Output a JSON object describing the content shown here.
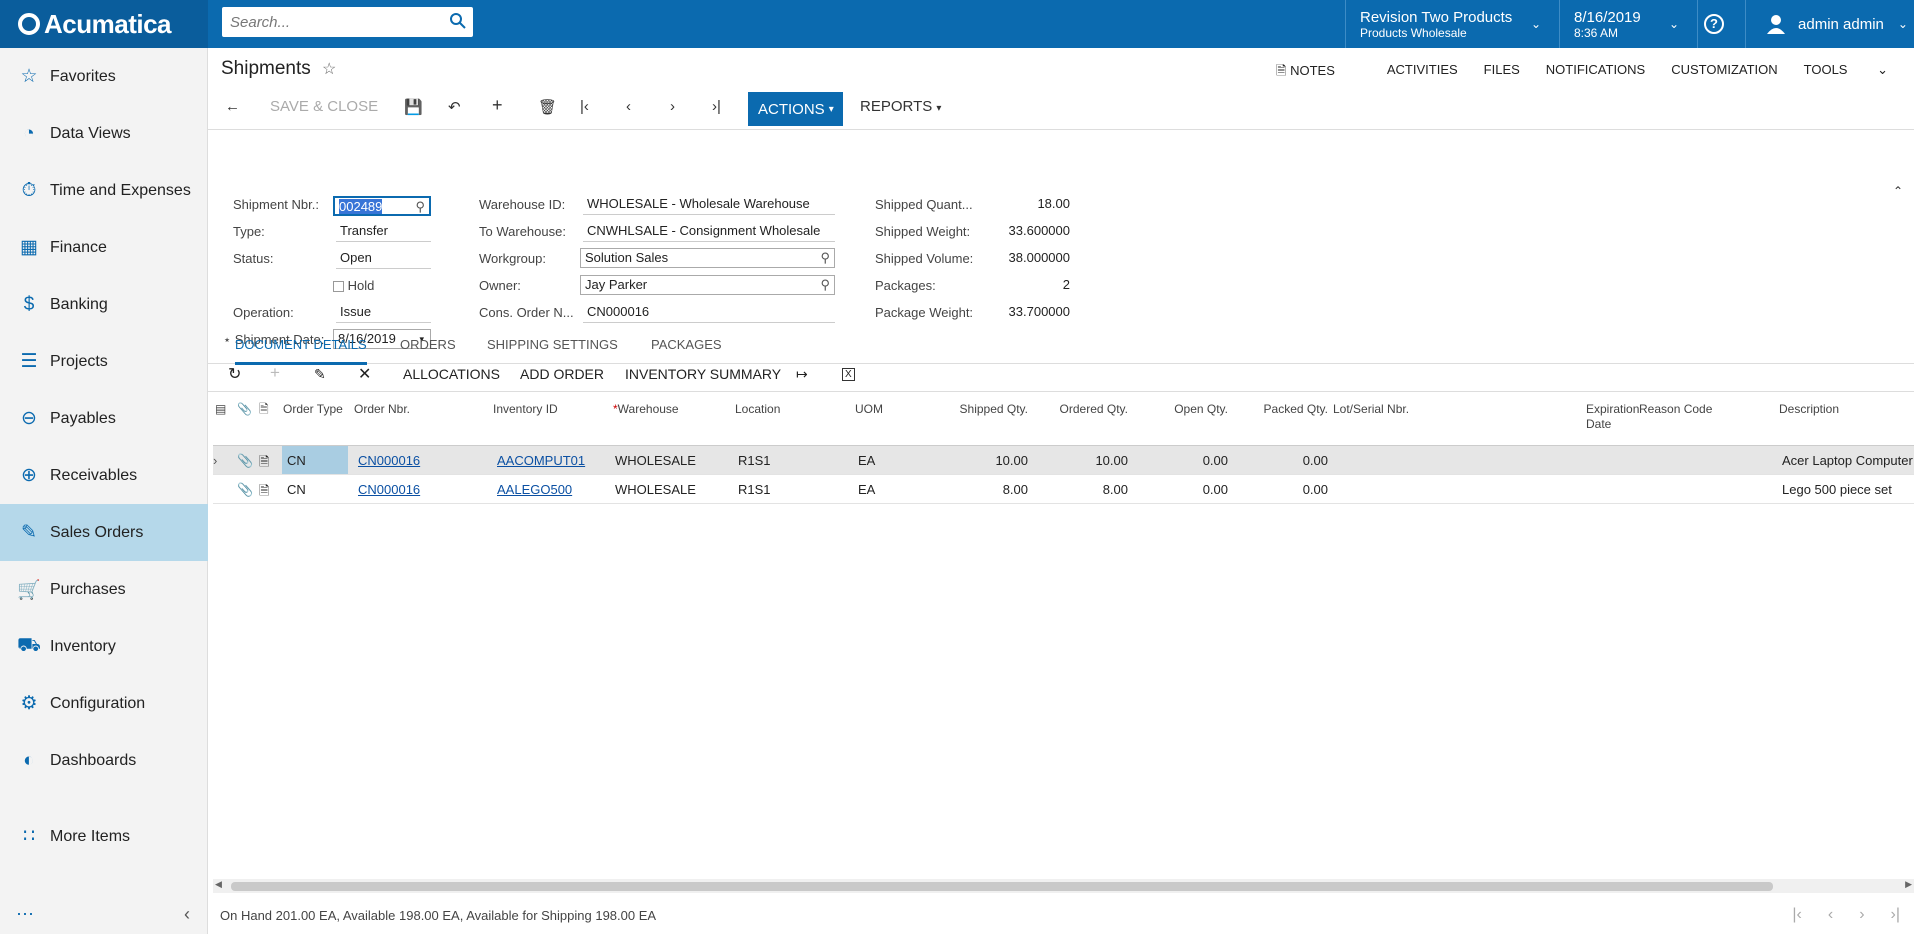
{
  "app": {
    "logo": "Acumatica"
  },
  "search": {
    "placeholder": "Search..."
  },
  "company": {
    "name": "Revision Two Products",
    "branch": "Products Wholesale"
  },
  "datetime": {
    "date": "8/16/2019",
    "time": "8:36 AM"
  },
  "user": {
    "name": "admin admin"
  },
  "sidebar": {
    "items": [
      {
        "label": "Favorites",
        "icon": "star-icon"
      },
      {
        "label": "Data Views",
        "icon": "data-views-icon"
      },
      {
        "label": "Time and Expenses",
        "icon": "stopwatch-icon"
      },
      {
        "label": "Finance",
        "icon": "calculator-icon"
      },
      {
        "label": "Banking",
        "icon": "dollar-icon"
      },
      {
        "label": "Projects",
        "icon": "projects-icon"
      },
      {
        "label": "Payables",
        "icon": "minus-circle-icon"
      },
      {
        "label": "Receivables",
        "icon": "plus-circle-icon"
      },
      {
        "label": "Sales Orders",
        "icon": "pencil-square-icon"
      },
      {
        "label": "Purchases",
        "icon": "cart-icon"
      },
      {
        "label": "Inventory",
        "icon": "truck-icon"
      },
      {
        "label": "Configuration",
        "icon": "gear-icon"
      },
      {
        "label": "Dashboards",
        "icon": "gauge-icon"
      },
      {
        "label": "More Items",
        "icon": "grid-dots-icon"
      }
    ]
  },
  "page": {
    "title": "Shipments"
  },
  "toplinks": [
    "NOTES",
    "ACTIVITIES",
    "FILES",
    "NOTIFICATIONS",
    "CUSTOMIZATION",
    "TOOLS"
  ],
  "toolbar": {
    "save_close": "SAVE & CLOSE",
    "actions": "ACTIONS",
    "reports": "REPORTS"
  },
  "form": {
    "shipment_nbr_label": "Shipment Nbr.:",
    "shipment_nbr": "002489",
    "type_label": "Type:",
    "type": "Transfer",
    "status_label": "Status:",
    "status": "Open",
    "hold_label": "Hold",
    "operation_label": "Operation:",
    "operation": "Issue",
    "shipment_date_label": "Shipment Date:",
    "shipment_date": "8/16/2019",
    "warehouse_label": "Warehouse ID:",
    "warehouse": "WHOLESALE - Wholesale Warehouse",
    "to_warehouse_label": "To Warehouse:",
    "to_warehouse": "CNWHLSALE - Consignment Wholesale",
    "workgroup_label": "Workgroup:",
    "workgroup": "Solution Sales",
    "owner_label": "Owner:",
    "owner": "Jay Parker",
    "cons_order_label": "Cons. Order N...",
    "cons_order": "CN000016",
    "shipped_qty_label": "Shipped Quant...",
    "shipped_qty": "18.00",
    "shipped_weight_label": "Shipped Weight:",
    "shipped_weight": "33.600000",
    "shipped_volume_label": "Shipped Volume:",
    "shipped_volume": "38.000000",
    "packages_label": "Packages:",
    "packages": "2",
    "package_weight_label": "Package Weight:",
    "package_weight": "33.700000"
  },
  "tabs": [
    "DOCUMENT DETAILS",
    "ORDERS",
    "SHIPPING SETTINGS",
    "PACKAGES"
  ],
  "grid_toolbar": {
    "allocations": "ALLOCATIONS",
    "add_order": "ADD ORDER",
    "inventory_summary": "INVENTORY SUMMARY"
  },
  "grid": {
    "headers": {
      "order_type": "Order Type",
      "order_nbr": "Order Nbr.",
      "inventory_id": "Inventory ID",
      "warehouse": "Warehouse",
      "location": "Location",
      "uom": "UOM",
      "shipped_qty": "Shipped Qty.",
      "ordered_qty": "Ordered Qty.",
      "open_qty": "Open Qty.",
      "packed_qty": "Packed Qty.",
      "lot_serial": "Lot/Serial Nbr.",
      "expiration": "Expiration Date",
      "reason": "Reason Code",
      "description": "Description"
    },
    "rows": [
      {
        "order_type": "CN",
        "order_nbr": "CN000016",
        "inventory_id": "AACOMPUT01",
        "warehouse": "WHOLESALE",
        "location": "R1S1",
        "uom": "EA",
        "shipped_qty": "10.00",
        "ordered_qty": "10.00",
        "open_qty": "0.00",
        "packed_qty": "0.00",
        "description": "Acer Laptop Computer"
      },
      {
        "order_type": "CN",
        "order_nbr": "CN000016",
        "inventory_id": "AALEGO500",
        "warehouse": "WHOLESALE",
        "location": "R1S1",
        "uom": "EA",
        "shipped_qty": "8.00",
        "ordered_qty": "8.00",
        "open_qty": "0.00",
        "packed_qty": "0.00",
        "description": "Lego 500 piece set"
      }
    ]
  },
  "status_bar": {
    "text": "On Hand 201.00 EA, Available 198.00 EA, Available for Shipping 198.00 EA"
  }
}
